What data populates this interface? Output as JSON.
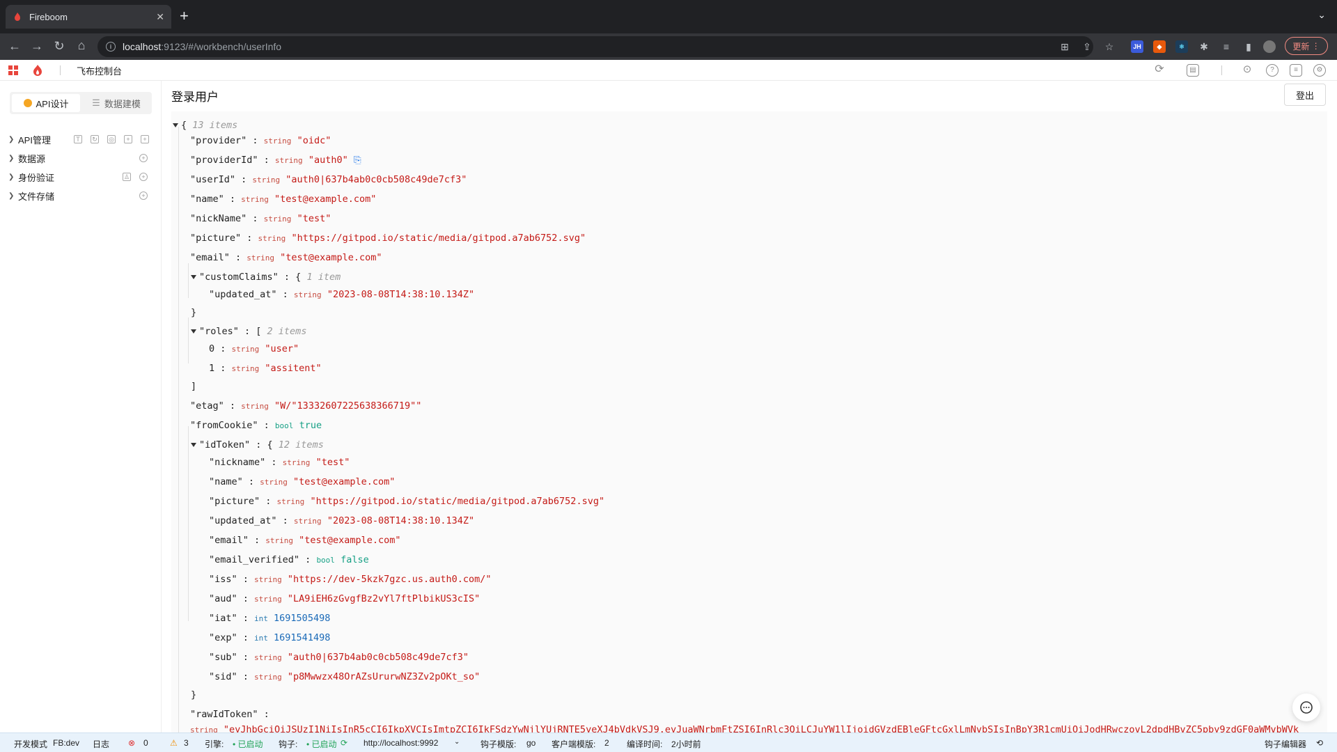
{
  "browser": {
    "tab_title": "Fireboom",
    "url_host": "localhost",
    "url_rest": ":9123/#/workbench/userInfo",
    "update_label": "更新"
  },
  "app": {
    "title": "飞布控制台"
  },
  "sidebar": {
    "tab_api": "API设计",
    "tab_model": "数据建模",
    "items": [
      "API管理",
      "数据源",
      "身份验证",
      "文件存储"
    ]
  },
  "main": {
    "page_title": "登录用户",
    "logout_label": "登出"
  },
  "json": {
    "root_meta": "13 items",
    "provider": "\"oidc\"",
    "providerId": "\"auth0\"",
    "userId": "\"auth0|637b4ab0c0cb508c49de7cf3\"",
    "name": "\"test@example.com\"",
    "nickName": "\"test\"",
    "picture": "\"https://gitpod.io/static/media/gitpod.a7ab6752.svg\"",
    "email": "\"test@example.com\"",
    "customClaims_meta": "1 item",
    "updated_at": "\"2023-08-08T14:38:10.134Z\"",
    "roles_meta": "2 items",
    "role0": "\"user\"",
    "role1": "\"assitent\"",
    "etag": "\"W/\"13332607225638366719\"\"",
    "fromCookie": "true",
    "idToken_meta": "12 items",
    "idToken": {
      "nickname": "\"test\"",
      "name": "\"test@example.com\"",
      "picture": "\"https://gitpod.io/static/media/gitpod.a7ab6752.svg\"",
      "updated_at": "\"2023-08-08T14:38:10.134Z\"",
      "email": "\"test@example.com\"",
      "email_verified": "false",
      "iss": "\"https://dev-5kzk7gzc.us.auth0.com/\"",
      "aud": "\"LA9iEH6zGvgfBz2vYl7ftPlbikUS3cIS\"",
      "iat": "1691505498",
      "exp": "1691541498",
      "sub": "\"auth0|637b4ab0c0cb508c49de7cf3\"",
      "sid": "\"p8Mwwzx48OrAZsUrurwNZ3Zv2pOKt_so\""
    },
    "rawIdToken_value": "\"eyJhbGciOiJSUzI1NiIsInR5cCI6IkpXVCIsImtpZCI6IkFSdzYwNjlYUjRNTE5yeXJ4bVdkVSJ9.eyJuaWNrbmFtZSI6InRlc3QiLCJuYW1lIjoidGVzdEBleGFtcGxlLmNvbSIsInBpY3R1cmUiOiJodHRwczovL2dpdHBvZC5pby9zdGF0aWMvbWVk"
  },
  "types": {
    "string": "string",
    "bool": "bool",
    "int": "int"
  },
  "status": {
    "mode": "开发模式",
    "fb": "FB:dev",
    "log": "日志",
    "errors": "0",
    "warnings": "3",
    "engine_label": "引擎:",
    "engine_status": "• 已启动",
    "hook_label": "钩子:",
    "hook_status": "• 已启动",
    "hook_url": "http://localhost:9992",
    "hook_template_label": "钩子模版:",
    "hook_template": "go",
    "client_template_label": "客户端模版:",
    "client_template": "2",
    "compile_label": "编译时间:",
    "compile_time": "2小时前",
    "hook_editor": "钩子编辑器"
  }
}
